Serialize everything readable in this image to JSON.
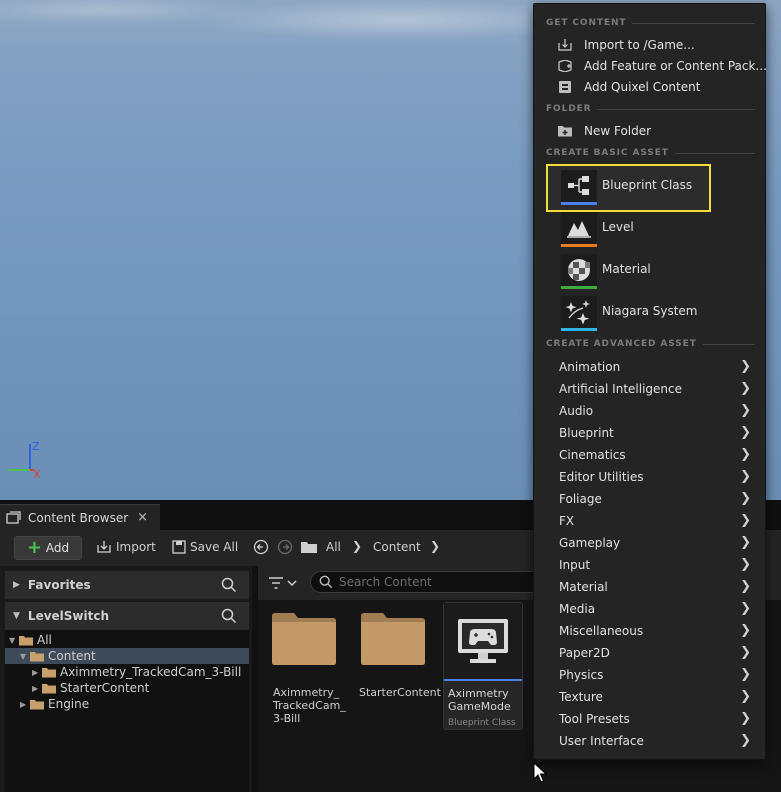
{
  "content_browser": {
    "tab_label": "Content Browser",
    "add_label": "Add",
    "import_label": "Import",
    "save_all_label": "Save All",
    "breadcrumbs": [
      "All",
      "Content"
    ],
    "favorites_label": "Favorites",
    "project_label": "LevelSwitch",
    "search_placeholder": "Search Content",
    "tree": {
      "all": "All",
      "content": "Content",
      "child1": "Aximmetry_TrackedCam_3-Bill",
      "child2": "StarterContent",
      "engine": "Engine"
    },
    "assets": {
      "folder1_label": "Aximmetry_\nTrackedCam_\n3-Bill",
      "folder2_label": "StarterContent",
      "bp_name": "Aximmetry\nGameMode",
      "bp_type": "Blueprint Class"
    }
  },
  "viewport": {
    "axis_z": "Z",
    "axis_x": "X"
  },
  "menu": {
    "headers": {
      "get_content": "GET CONTENT",
      "folder": "FOLDER",
      "create_basic": "CREATE BASIC ASSET",
      "create_advanced": "CREATE ADVANCED ASSET"
    },
    "get_content_items": [
      "Import to /Game...",
      "Add Feature or Content Pack...",
      "Add Quixel Content"
    ],
    "folder_items": [
      "New Folder"
    ],
    "basic_assets": [
      {
        "label": "Blueprint Class",
        "color": "#4a7ee8"
      },
      {
        "label": "Level",
        "color": "#e87a20"
      },
      {
        "label": "Material",
        "color": "#3dab3d"
      },
      {
        "label": "Niagara System",
        "color": "#2fb4e6"
      }
    ],
    "advanced_assets": [
      "Animation",
      "Artificial Intelligence",
      "Audio",
      "Blueprint",
      "Cinematics",
      "Editor Utilities",
      "Foliage",
      "FX",
      "Gameplay",
      "Input",
      "Material",
      "Media",
      "Miscellaneous",
      "Paper2D",
      "Physics",
      "Texture",
      "Tool Presets",
      "User Interface"
    ],
    "highlight_color": "#f1dd3a"
  }
}
